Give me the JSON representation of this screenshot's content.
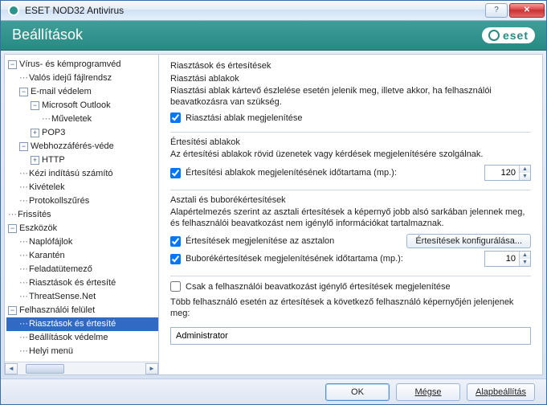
{
  "window": {
    "title": "ESET NOD32 Antivirus"
  },
  "banner": {
    "title": "Beállítások",
    "logo_text": "eset"
  },
  "tree": {
    "n_virus": "Vírus- és kémprogramvéd",
    "n_realtime": "Valós idejű fájlrendsz",
    "n_email": "E-mail védelem",
    "n_outlook": "Microsoft Outlook",
    "n_muveletek": "Műveletek",
    "n_pop3": "POP3",
    "n_web": "Webhozzáférés-véde",
    "n_http": "HTTP",
    "n_kezi": "Kézi indítású számító",
    "n_kivetelek": "Kivételek",
    "n_protokoll": "Protokollszűrés",
    "n_frissites": "Frissítés",
    "n_eszkozok": "Eszközök",
    "n_naplo": "Naplófájlok",
    "n_karanten": "Karantén",
    "n_feladat": "Feladatütemező",
    "n_riasztasok": "Riasztások és értesíté",
    "n_threatsense": "ThreatSense.Net",
    "n_ui": "Felhasználói felület",
    "n_riaszt2": "Riasztások és értesíté",
    "n_beallved": "Beállítások védelme",
    "n_helyi": "Helyi menü"
  },
  "content": {
    "main_title": "Riasztások és értesítések",
    "group1_title": "Riasztási ablakok",
    "group1_desc": "Riasztási ablak kártevő észlelése esetén jelenik meg, illetve akkor, ha felhasználói beavatkozásra van szükség.",
    "chk_alert_window": "Riasztási ablak megjelenítése",
    "group2_title": "Értesítési ablakok",
    "group2_desc": "Az értesítési ablakok rövid üzenetek vagy kérdések megjelenítésére szolgálnak.",
    "chk_notif_duration": "Értesítési ablakok megjelenítésének időtartama (mp.):",
    "notif_duration_value": "120",
    "group3_title": "Asztali és buborékértesítések",
    "group3_desc": "Alapértelmezés szerint az asztali értesítések a képernyő jobb alsó sarkában jelennek meg, és felhasználói beavatkozást nem igénylő információkat tartalmaznak.",
    "chk_desktop_notif": "Értesítések megjelenítése az asztalon",
    "btn_config_notif": "Értesítések konfigurálása...",
    "chk_balloon_duration": "Buborékértesítések megjelenítésének időtartama (mp.):",
    "balloon_duration_value": "10",
    "chk_only_interaction": "Csak a felhasználói beavatkozást igénylő értesítések megjelenítése",
    "multi_user_desc": "Több felhasználó esetén az értesítések a következő felhasználó képernyőjén jelenjenek meg:",
    "user_value": "Administrator"
  },
  "footer": {
    "ok": "OK",
    "cancel": "Mégse",
    "default": "Alapbeállítás"
  }
}
